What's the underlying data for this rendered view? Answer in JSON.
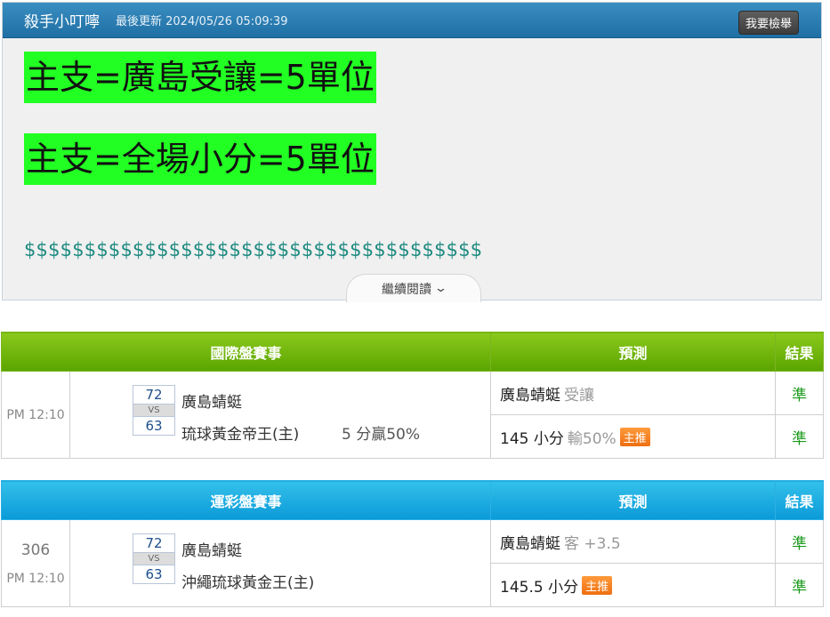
{
  "article": {
    "author": "殺手小叮嚀",
    "updated": "最後更新 2024/05/26 05:09:39",
    "report_button": "我要檢舉",
    "line1": "主支=廣島受讓=5單位",
    "line2": "主支=全場小分=5單位",
    "dollars": "$$$$$$$$$$$$$$$$$$$$$$$$$$$$$$$$$$$$$$",
    "read_more": "繼續閱讀",
    "read_more_icon": "chevron-down-icon"
  },
  "table1": {
    "headers": [
      "國際盤賽事",
      "預測",
      "結果"
    ],
    "time": "PM 12:10",
    "score_top": "72",
    "vs": "VS",
    "score_bottom": "63",
    "team_top": "廣島蜻蜓",
    "team_bottom": "琉球黃金帝王(主)",
    "extra": "5 分贏50%",
    "pred1_team": "廣島蜻蜓",
    "pred1_type": "受讓",
    "result1": "準",
    "pred2_main": "145 小分",
    "pred2_note": "輸50%",
    "pred2_badge": "主推",
    "result2": "準",
    "accent": "#5aa400"
  },
  "table2": {
    "headers": [
      "運彩盤賽事",
      "預測",
      "結果"
    ],
    "game_no": "306",
    "time": "PM 12:10",
    "score_top": "72",
    "vs": "VS",
    "score_bottom": "63",
    "team_top": "廣島蜻蜓",
    "team_bottom": "沖繩琉球黃金王(主)",
    "pred1_team": "廣島蜻蜓",
    "pred1_type": "客 +3.5",
    "result1": "準",
    "pred2_main": "145.5 小分",
    "pred2_badge": "主推",
    "result2": "準",
    "accent": "#0a9ad8"
  }
}
